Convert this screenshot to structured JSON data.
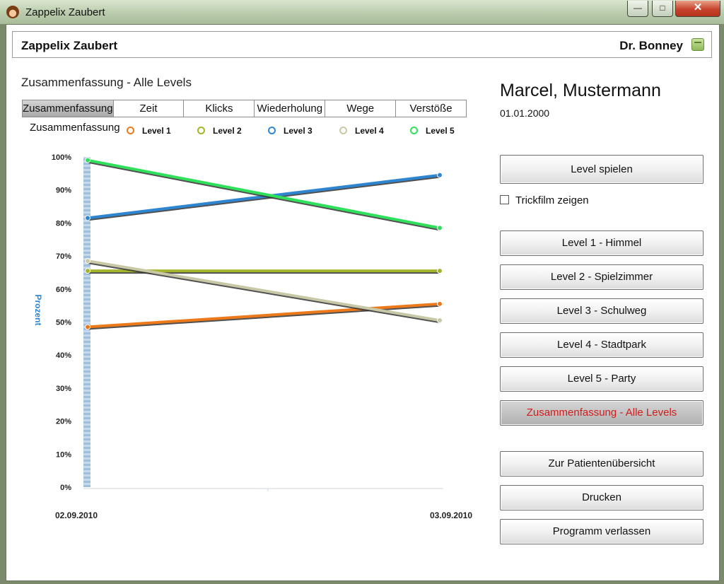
{
  "window": {
    "title": "Zappelix Zaubert",
    "controls": {
      "minimize": "—",
      "maximize": "□",
      "close": "✕"
    }
  },
  "header": {
    "app_name": "Zappelix Zaubert",
    "doctor": "Dr. Bonney",
    "icon": "calendar-icon"
  },
  "main": {
    "section_title": "Zusammenfassung - Alle Levels",
    "tabs": [
      {
        "label": "Zusammenfassung",
        "active": true
      },
      {
        "label": "Zeit",
        "active": false
      },
      {
        "label": "Klicks",
        "active": false
      },
      {
        "label": "Wiederholung",
        "active": false
      },
      {
        "label": "Wege",
        "active": false
      },
      {
        "label": "Verstöße",
        "active": false
      }
    ],
    "chart_label": "Zusammenfassung"
  },
  "chart_data": {
    "type": "line",
    "title": "Zusammenfassung",
    "ylabel": "Prozent",
    "xlabel": "",
    "x": [
      "02.09.2010",
      "03.09.2010"
    ],
    "ylim": [
      0,
      100
    ],
    "yticks": [
      "100%",
      "90%",
      "80%",
      "70%",
      "60%",
      "50%",
      "40%",
      "30%",
      "20%",
      "10%",
      "0%"
    ],
    "legend_position": "top",
    "grid": false,
    "series": [
      {
        "name": "Level 1",
        "color": "#ec7a1a",
        "values": [
          48.5,
          55.5
        ]
      },
      {
        "name": "Level 2",
        "color": "#a5b52b",
        "values": [
          65.5,
          65.5
        ]
      },
      {
        "name": "Level 3",
        "color": "#2f86d0",
        "values": [
          81.5,
          94.5
        ]
      },
      {
        "name": "Level 4",
        "color": "#c8c8a6",
        "values": [
          68.5,
          50.5
        ]
      },
      {
        "name": "Level 5",
        "color": "#2fe05a",
        "values": [
          99.0,
          78.5
        ]
      }
    ]
  },
  "patient": {
    "name": "Marcel, Mustermann",
    "birthdate": "01.01.2000"
  },
  "sidebar": {
    "play_button": "Level spielen",
    "cartoon_checkbox": {
      "label": "Trickfilm zeigen",
      "checked": false
    },
    "level_buttons": [
      {
        "label": "Level 1 - Himmel",
        "active": false
      },
      {
        "label": "Level 2 - Spielzimmer",
        "active": false
      },
      {
        "label": "Level 3 - Schulweg",
        "active": false
      },
      {
        "label": "Level 4 - Stadtpark",
        "active": false
      },
      {
        "label": "Level 5 - Party",
        "active": false
      },
      {
        "label": "Zusammenfassung - Alle Levels",
        "active": true
      }
    ],
    "patient_overview_button": "Zur Patientenübersicht",
    "print_button": "Drucken",
    "exit_button": "Programm verlassen"
  }
}
